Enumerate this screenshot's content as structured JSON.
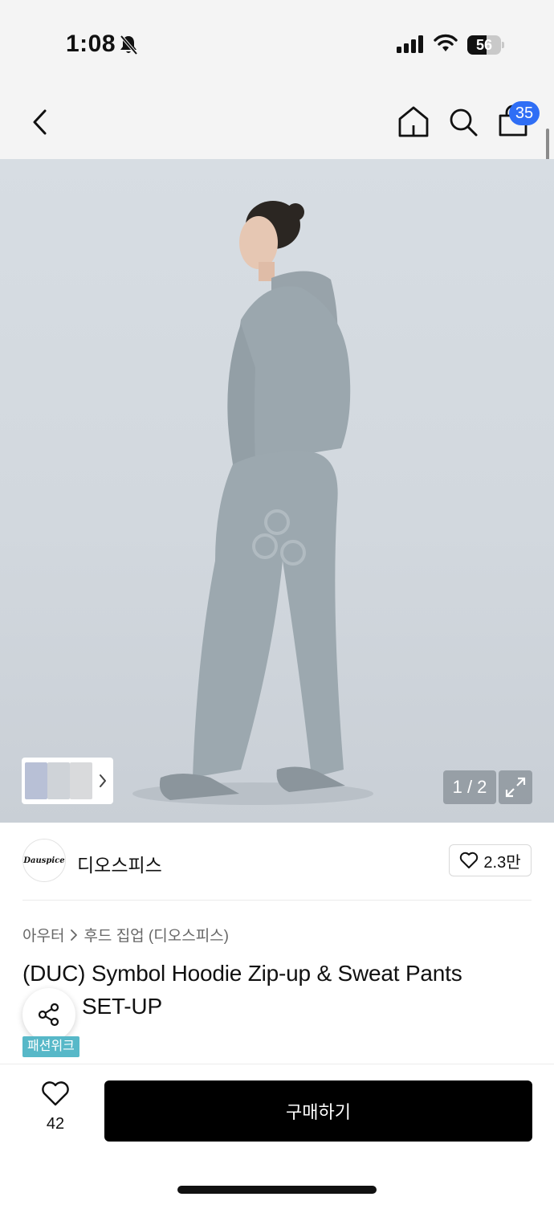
{
  "status_bar": {
    "time": "1:08",
    "battery_level": "56",
    "battery_fraction": 0.56
  },
  "header": {
    "cart_count": "35"
  },
  "icons": {
    "back": "chevron-left-icon",
    "home": "home-icon",
    "search": "search-icon",
    "cart": "shopping-bag-icon",
    "bell_muted": "bell-slash-icon",
    "expand": "expand-icon",
    "share": "share-icon",
    "heart": "heart-icon"
  },
  "gallery": {
    "counter": "1 / 2",
    "current": 1,
    "total": 2
  },
  "brand": {
    "logo_text": "Dauspice",
    "name": "디오스피스",
    "likes": "2.3만"
  },
  "product": {
    "breadcrumb": [
      "아우터",
      "후드 집업 (디오스피스)"
    ],
    "title_line1": "(DUC) Symbol Hoodie Zip-up & Sweat Pants",
    "title_line2": "SET-UP",
    "badge": "패션위크"
  },
  "bottom": {
    "wish_count": "42",
    "buy_label": "구매하기"
  },
  "colors": {
    "accent_badge": "#2f6ef5",
    "event_badge": "#57b8c8",
    "buy_button": "#000000",
    "product_grey": "#9aa6ad"
  }
}
